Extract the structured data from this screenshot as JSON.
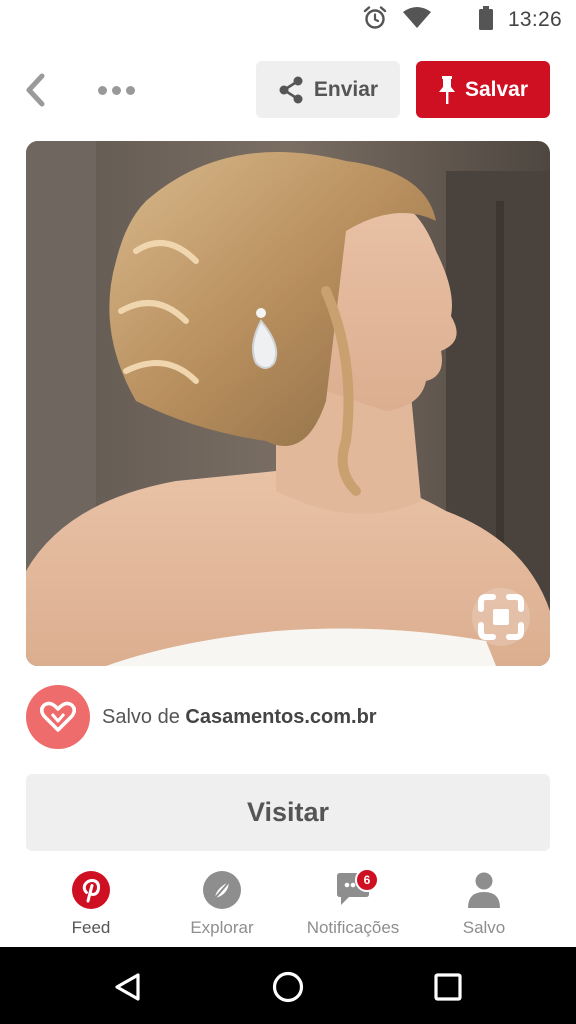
{
  "status_bar": {
    "time": "13:26",
    "icons": [
      "alarm-icon",
      "wifi-icon",
      "battery-icon"
    ]
  },
  "top_bar": {
    "back_icon": "chevron-left-icon",
    "more_icon": "more-horizontal-icon",
    "enviar_label": "Enviar",
    "salvar_label": "Salvar"
  },
  "pin": {
    "lens_icon": "visual-search-icon"
  },
  "attribution": {
    "prefix": "Salvo de ",
    "source": "Casamentos.com.br",
    "avatar_icon": "heart-icon"
  },
  "visit": {
    "label": "Visitar"
  },
  "bottom_nav": {
    "items": [
      {
        "label": "Feed",
        "icon": "pinterest-logo-icon"
      },
      {
        "label": "Explorar",
        "icon": "compass-icon"
      },
      {
        "label": "Notificações",
        "icon": "chat-bubble-icon",
        "badge": "6"
      },
      {
        "label": "Salvo",
        "icon": "person-icon"
      }
    ]
  },
  "colors": {
    "brand_red": "#cf0f22",
    "avatar_coral": "#ef6c6c",
    "button_gray": "#efefef"
  },
  "system_nav": {
    "icons": [
      "back-triangle-icon",
      "home-circle-icon",
      "recents-square-icon"
    ]
  }
}
